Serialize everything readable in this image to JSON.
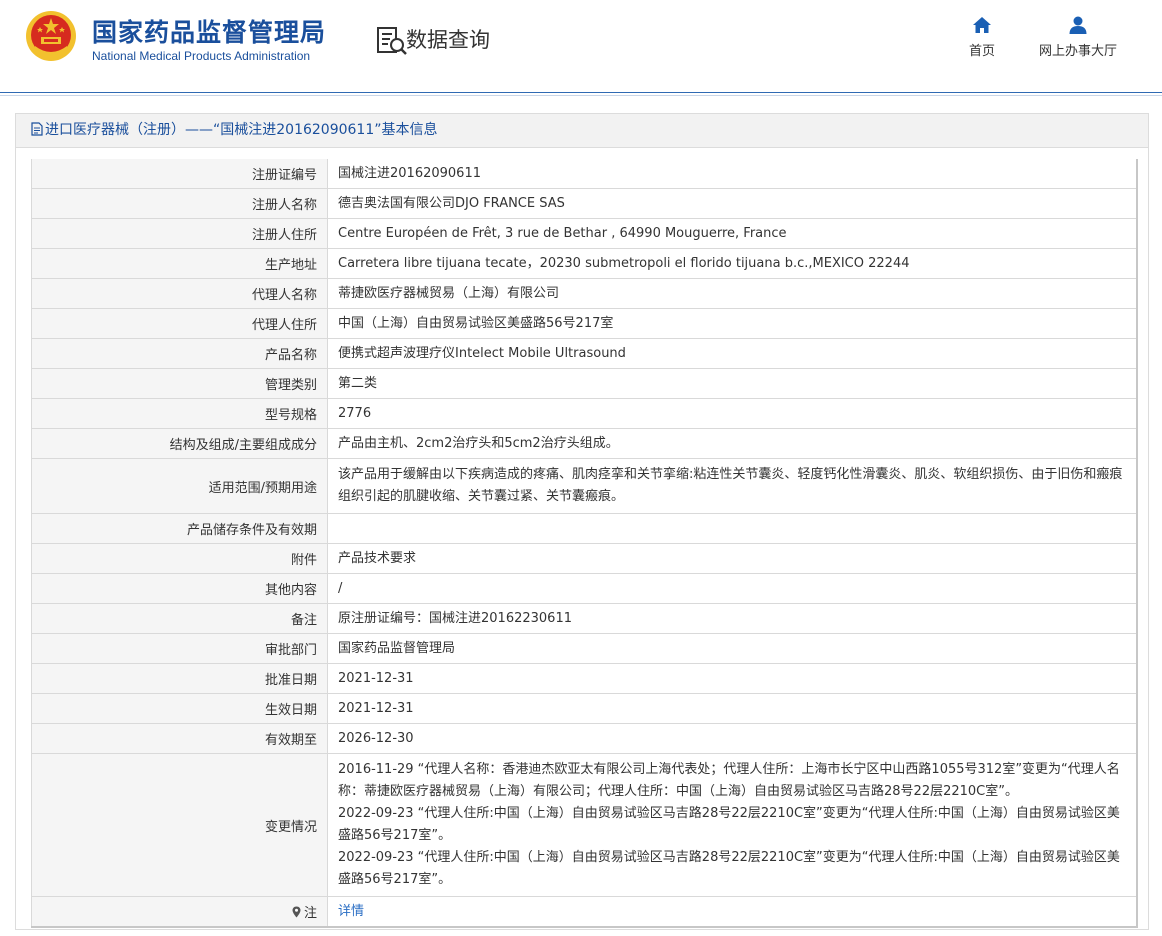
{
  "header": {
    "title_cn": "国家药品监督管理局",
    "title_en": "National Medical Products Administration",
    "section_title": "数据查询",
    "nav": [
      {
        "label": "首页",
        "icon": "home-icon"
      },
      {
        "label": "网上办事大厅",
        "icon": "user-icon"
      }
    ]
  },
  "panel": {
    "title": "进口医疗器械（注册）——“国械注进20162090611”基本信息"
  },
  "fields": [
    {
      "label": "注册证编号",
      "value": "国械注进20162090611"
    },
    {
      "label": "注册人名称",
      "value": "德吉奥法国有限公司DJO FRANCE SAS"
    },
    {
      "label": "注册人住所",
      "value": "Centre Européen de Frêt, 3 rue de Bethar , 64990 Mouguerre, France"
    },
    {
      "label": "生产地址",
      "value": "Carretera libre tijuana tecate，20230 submetropoli el florido tijuana b.c.,MEXICO 22244"
    },
    {
      "label": "代理人名称",
      "value": "蒂捷欧医疗器械贸易（上海）有限公司"
    },
    {
      "label": "代理人住所",
      "value": "中国（上海）自由贸易试验区美盛路56号217室"
    },
    {
      "label": "产品名称",
      "value": "便携式超声波理疗仪Intelect Mobile Ultrasound"
    },
    {
      "label": "管理类别",
      "value": "第二类"
    },
    {
      "label": "型号规格",
      "value": "2776"
    },
    {
      "label": "结构及组成/主要组成成分",
      "value": "产品由主机、2cm2治疗头和5cm2治疗头组成。"
    },
    {
      "label": "适用范围/预期用途",
      "value": "该产品用于缓解由以下疾病造成的疼痛、肌肉痉挛和关节挛缩:粘连性关节囊炎、轻度钙化性滑囊炎、肌炎、软组织损伤、由于旧伤和瘢痕组织引起的肌腱收缩、关节囊过紧、关节囊瘢痕。"
    },
    {
      "label": "产品储存条件及有效期",
      "value": ""
    },
    {
      "label": "附件",
      "value": "产品技术要求"
    },
    {
      "label": "其他内容",
      "value": "/"
    },
    {
      "label": "备注",
      "value": "原注册证编号：国械注进20162230611"
    },
    {
      "label": "审批部门",
      "value": "国家药品监督管理局"
    },
    {
      "label": "批准日期",
      "value": "2021-12-31"
    },
    {
      "label": "生效日期",
      "value": "2021-12-31"
    },
    {
      "label": "有效期至",
      "value": "2026-12-30"
    }
  ],
  "changes": {
    "label": "变更情况",
    "lines": [
      "2016-11-29 “代理人名称：香港迪杰欧亚太有限公司上海代表处；代理人住所：上海市长宁区中山西路1055号312室”变更为“代理人名称：蒂捷欧医疗器械贸易（上海）有限公司；代理人住所：中国（上海）自由贸易试验区马吉路28号22层2210C室”。",
      "2022-09-23 “代理人住所:中国（上海）自由贸易试验区马吉路28号22层2210C室”变更为“代理人住所:中国（上海）自由贸易试验区美盛路56号217室”。",
      "2022-09-23 “代理人住所:中国（上海）自由贸易试验区马吉路28号22层2210C室”变更为“代理人住所:中国（上海）自由贸易试验区美盛路56号217室”。"
    ]
  },
  "note": {
    "label": "注",
    "link": "详情",
    "icon": "pin-icon"
  },
  "colors": {
    "brand_blue": "#1a4f9c",
    "link_blue": "#2a6ec4",
    "label_bg": "#f5f5f5",
    "emblem_red": "#d62b1f",
    "emblem_gold": "#f2c12e"
  }
}
